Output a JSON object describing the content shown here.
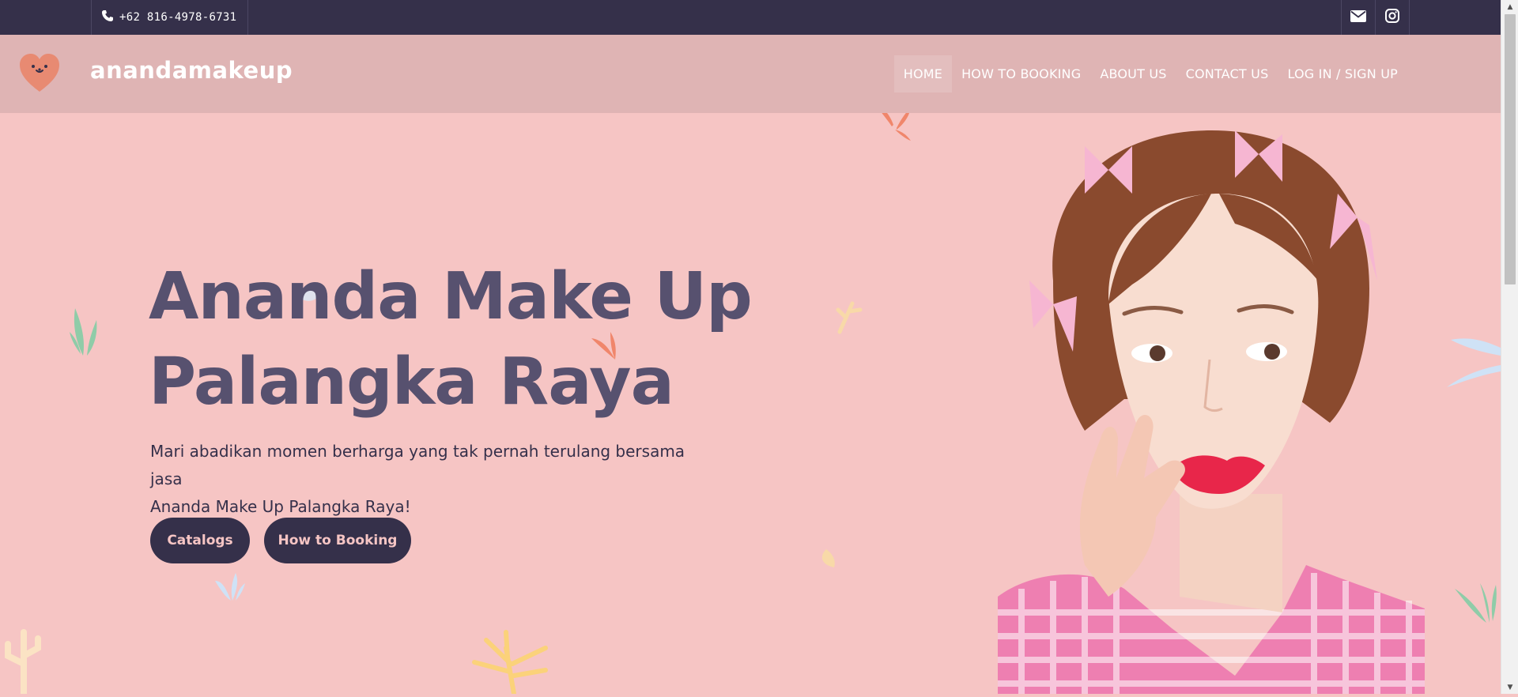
{
  "topbar": {
    "phone": "+62 816-4978-6731",
    "phone_icon": "phone-icon",
    "socials": [
      {
        "icon": "envelope-icon"
      },
      {
        "icon": "instagram-icon"
      }
    ]
  },
  "header": {
    "brand": "anandamakeup",
    "logo_icon": "heart-logo-icon",
    "nav": [
      {
        "label": "HOME",
        "active": true
      },
      {
        "label": "HOW TO BOOKING"
      },
      {
        "label": "ABOUT US"
      },
      {
        "label": "CONTACT US"
      },
      {
        "label": "LOG IN / SIGN UP"
      }
    ]
  },
  "hero": {
    "title_line1": "Ananda Make Up",
    "title_line2": "Palangka Raya",
    "text_line1": "Mari abadikan momen berharga yang tak pernah terulang bersama jasa",
    "text_line2": "Ananda Make Up Palangka Raya!",
    "buttons": {
      "catalogs": "Catalogs",
      "booking": "How to Booking"
    }
  },
  "colors": {
    "background": "#f6c5c4",
    "header": "#dfb4b4",
    "topbar": "#35304a",
    "title": "#57516f",
    "button": "#35304a",
    "button_text": "#f6c5c4"
  }
}
